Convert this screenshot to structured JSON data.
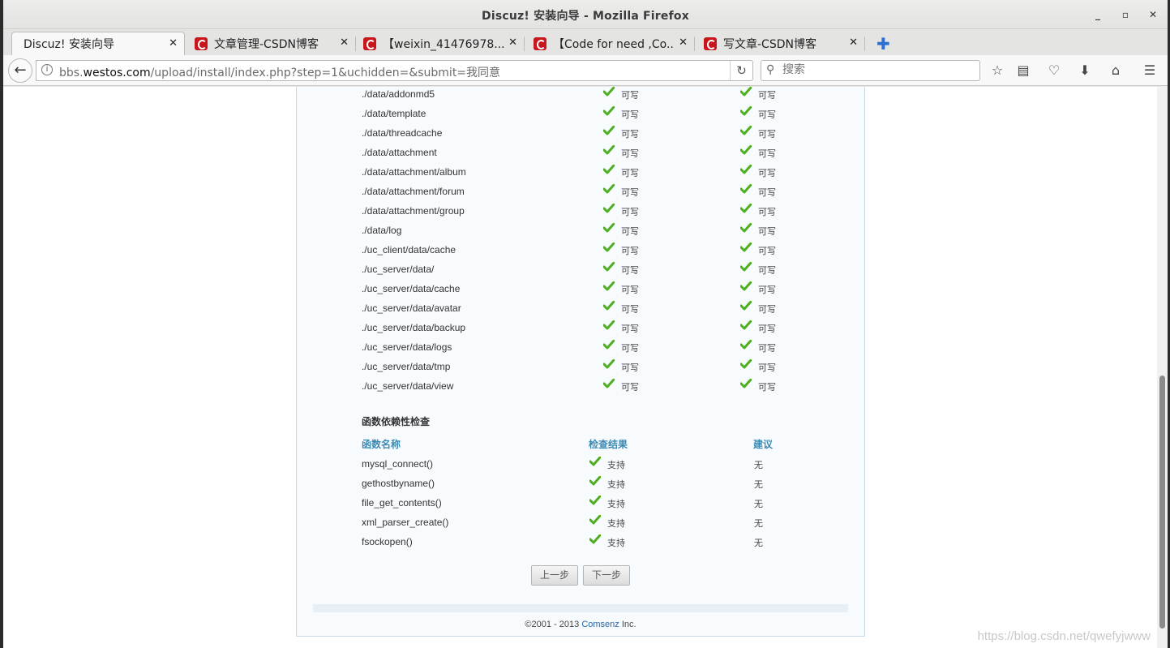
{
  "window": {
    "title": "Discuz! 安装向导 - Mozilla Firefox"
  },
  "tabs": [
    {
      "label": "Discuz! 安装向导",
      "active": true
    },
    {
      "label": "文章管理-CSDN博客"
    },
    {
      "label": "【weixin_41476978..."
    },
    {
      "label": "【Code for need ,Co..."
    },
    {
      "label": "写文章-CSDN博客"
    }
  ],
  "navbar": {
    "url_prefix": "bbs.",
    "url_host": "westos.com",
    "url_path": "/upload/install/index.php?step=1&uchidden=&submit=我同意",
    "search_placeholder": "搜索"
  },
  "dir_checks": {
    "rows": [
      {
        "path": "./data/addonmd5",
        "current": "可写",
        "required": "可写"
      },
      {
        "path": "./data/template",
        "current": "可写",
        "required": "可写"
      },
      {
        "path": "./data/threadcache",
        "current": "可写",
        "required": "可写"
      },
      {
        "path": "./data/attachment",
        "current": "可写",
        "required": "可写"
      },
      {
        "path": "./data/attachment/album",
        "current": "可写",
        "required": "可写"
      },
      {
        "path": "./data/attachment/forum",
        "current": "可写",
        "required": "可写"
      },
      {
        "path": "./data/attachment/group",
        "current": "可写",
        "required": "可写"
      },
      {
        "path": "./data/log",
        "current": "可写",
        "required": "可写"
      },
      {
        "path": "./uc_client/data/cache",
        "current": "可写",
        "required": "可写"
      },
      {
        "path": "./uc_server/data/",
        "current": "可写",
        "required": "可写"
      },
      {
        "path": "./uc_server/data/cache",
        "current": "可写",
        "required": "可写"
      },
      {
        "path": "./uc_server/data/avatar",
        "current": "可写",
        "required": "可写"
      },
      {
        "path": "./uc_server/data/backup",
        "current": "可写",
        "required": "可写"
      },
      {
        "path": "./uc_server/data/logs",
        "current": "可写",
        "required": "可写"
      },
      {
        "path": "./uc_server/data/tmp",
        "current": "可写",
        "required": "可写"
      },
      {
        "path": "./uc_server/data/view",
        "current": "可写",
        "required": "可写"
      }
    ]
  },
  "func_checks": {
    "title": "函数依赖性检查",
    "headers": {
      "name": "函数名称",
      "result": "检查结果",
      "advice": "建议"
    },
    "rows": [
      {
        "name": "mysql_connect()",
        "result": "支持",
        "advice": "无"
      },
      {
        "name": "gethostbyname()",
        "result": "支持",
        "advice": "无"
      },
      {
        "name": "file_get_contents()",
        "result": "支持",
        "advice": "无"
      },
      {
        "name": "xml_parser_create()",
        "result": "支持",
        "advice": "无"
      },
      {
        "name": "fsockopen()",
        "result": "支持",
        "advice": "无"
      }
    ]
  },
  "buttons": {
    "prev": "上一步",
    "next": "下一步"
  },
  "footer": {
    "prefix": "©2001 - 2013 ",
    "brand": "Comsenz",
    "suffix": " Inc."
  },
  "watermark": "https://blog.csdn.net/qwefyjwww",
  "colors": {
    "check_green": "#4caf1f",
    "header_blue": "#3c8ab3",
    "brand_blue": "#2764a8"
  }
}
